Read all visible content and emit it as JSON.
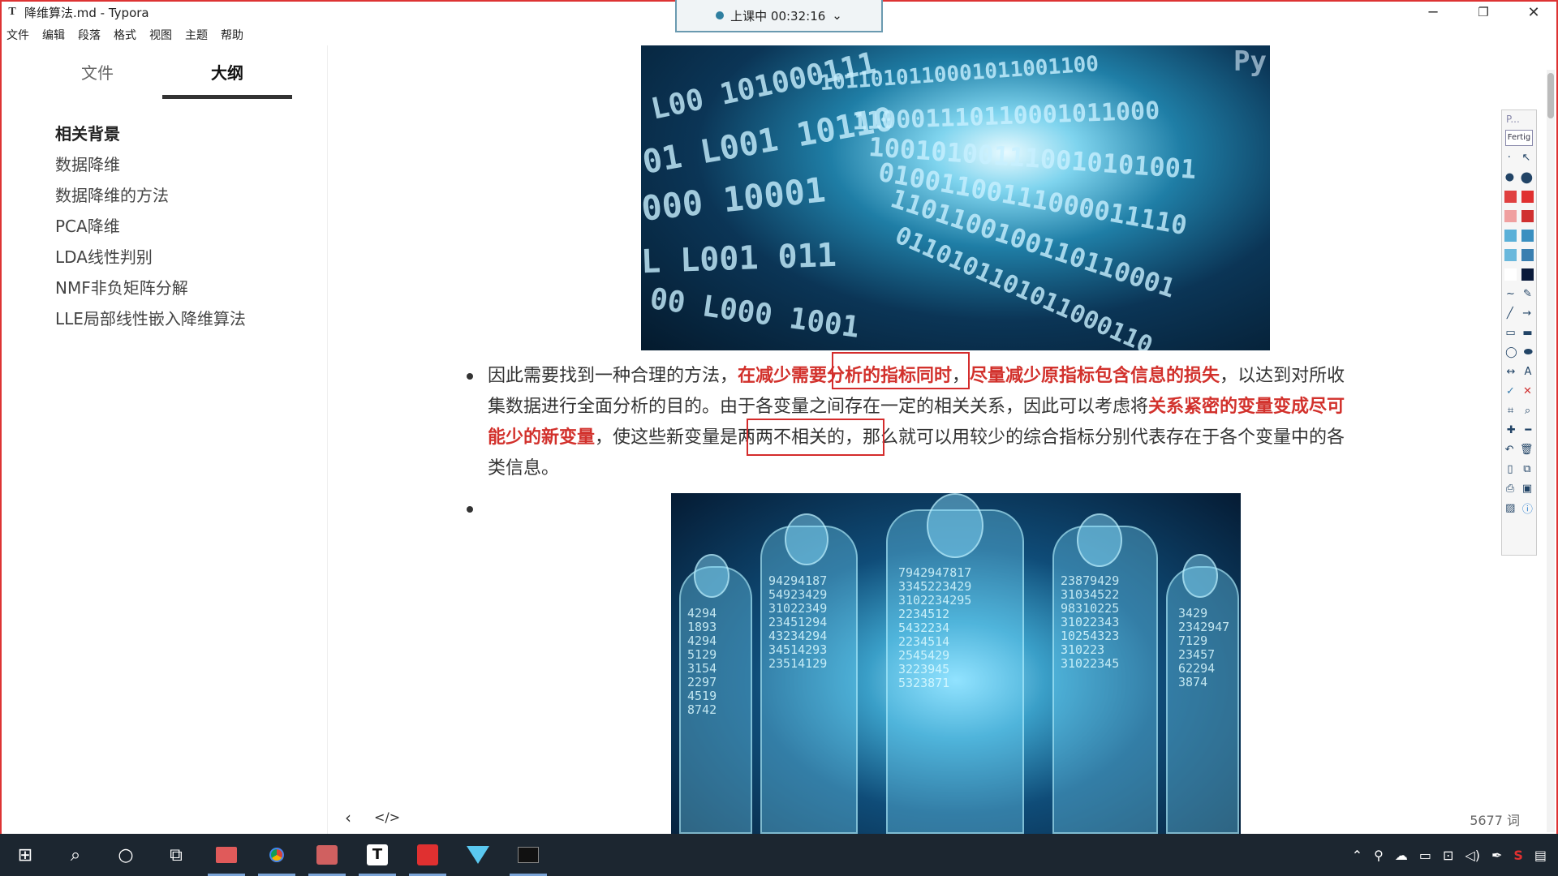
{
  "window": {
    "title": "降维算法.md - Typora",
    "app_icon": "T"
  },
  "menu": [
    "文件",
    "编辑",
    "段落",
    "格式",
    "视图",
    "主题",
    "帮助"
  ],
  "timer": {
    "label": "上课中 00:32:16",
    "arrow": "⌄"
  },
  "sidebar": {
    "tabs": [
      {
        "label": "文件"
      },
      {
        "label": "大纲"
      }
    ],
    "outline": [
      "相关背景",
      "数据降维",
      "数据降维的方法",
      "PCA降维",
      "LDA线性判别",
      "NMF非负矩阵分解",
      "LLE局部线性嵌入降维算法"
    ]
  },
  "content": {
    "image1_overlay": "Py",
    "paragraph": {
      "l1a": "因此需要找到一种合理的方法，",
      "l1b": "在减少需要分析的指标同时",
      "l1c": "，",
      "l1d": "尽量减少原指标包含信息的损失",
      "l1e": "，以达到对所收",
      "l2a": "集数据进行全面分析的目的。由于各变量之间存在一定的相关关系，因此可以考虑将",
      "l2b": "关系紧密的变量变成尽可",
      "l3a": "能少的新变量",
      "l3b": "，使这些新变量是两两不相关的，那么就可以用较少的综合指标分别代表存在于各个变量中的各",
      "l4": "类信息。"
    }
  },
  "footer": {
    "prev": "‹",
    "code": "</>",
    "word_count": "5677 词"
  },
  "palette": {
    "head": "P...",
    "fertig": "Fertig"
  },
  "taskbar": {
    "apps": [
      "windows-start",
      "search",
      "cortana",
      "task-view",
      "slides",
      "chrome",
      "paint",
      "typora",
      "pdf",
      "player",
      "terminal"
    ]
  }
}
